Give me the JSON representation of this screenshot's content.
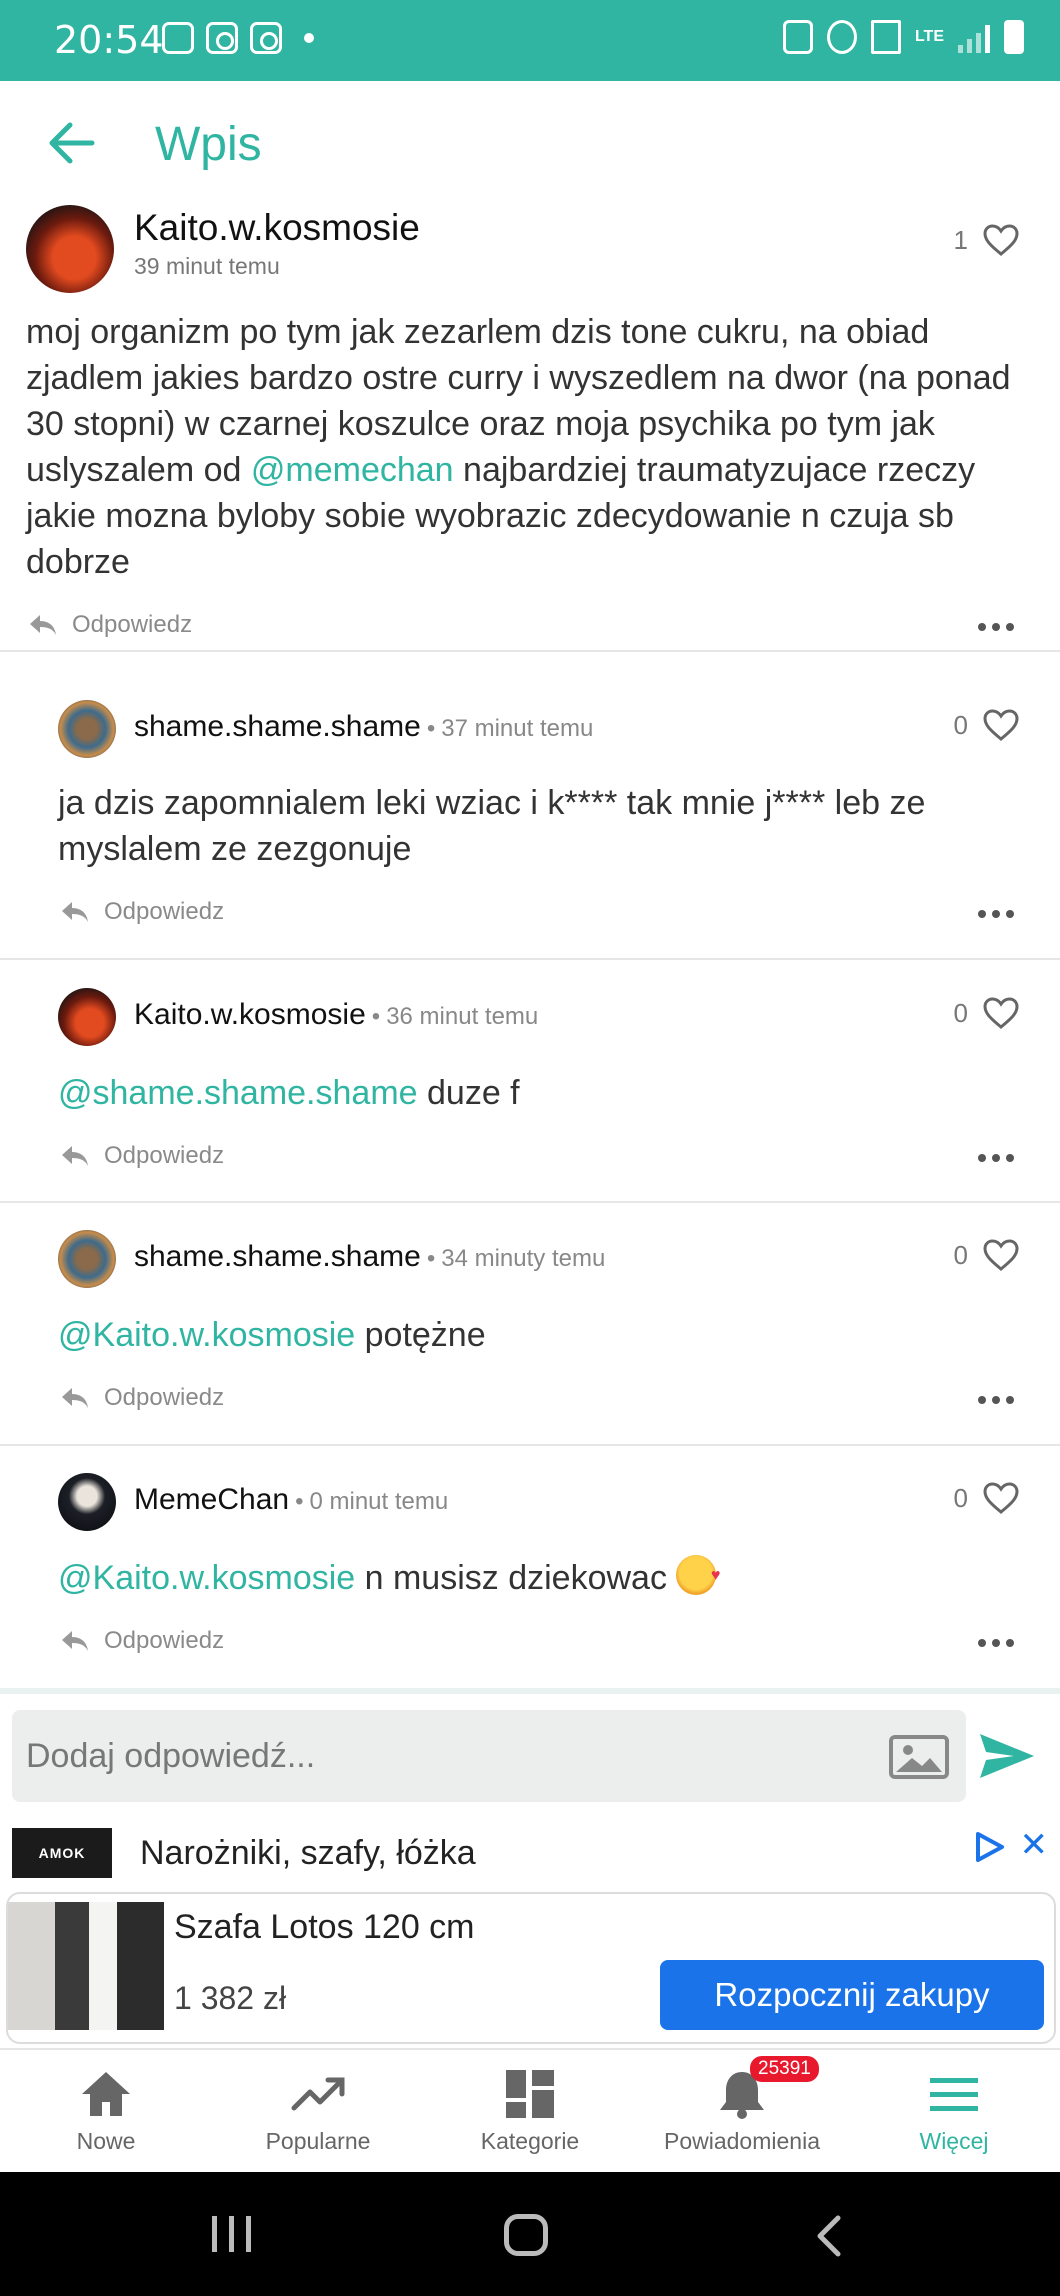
{
  "status_bar": {
    "time": "20:54",
    "network": "LTE"
  },
  "header": {
    "title": "Wpis",
    "back_icon": "back-arrow-icon"
  },
  "post": {
    "author": "Kaito.w.kosmosie",
    "time": "39 minut temu",
    "likes": "1",
    "body_part1": "moj organizm po tym jak zezarlem dzis tone cukru, na obiad zjadlem jakies bardzo ostre curry i wyszedlem na dwor (na ponad 30 stopni) w czarnej koszulce oraz moja psychika po tym jak uslyszalem od ",
    "body_mention": "@memechan",
    "body_part2": " najbardziej traumatyzujace rzeczy jakie mozna byloby sobie wyobrazic zdecydowanie n czuja sb dobrze",
    "reply_label": "Odpowiedz"
  },
  "comments": [
    {
      "author": "shame.shame.shame",
      "separator": "•",
      "time": "37 minut temu",
      "likes": "0",
      "mention": "",
      "text": "ja dzis zapomnialem leki wziac i k**** tak mnie j**** leb ze myslalem ze zezgonuje",
      "reply_label": "Odpowiedz"
    },
    {
      "author": "Kaito.w.kosmosie",
      "separator": "•",
      "time": "36 minut temu",
      "likes": "0",
      "mention": "@shame.shame.shame",
      "text": " duze f",
      "reply_label": "Odpowiedz"
    },
    {
      "author": "shame.shame.shame",
      "separator": "•",
      "time": "34 minuty temu",
      "likes": "0",
      "mention": "@Kaito.w.kosmosie",
      "text": " potężne",
      "reply_label": "Odpowiedz"
    },
    {
      "author": "MemeChan",
      "separator": "•",
      "time": "0 minut temu",
      "likes": "0",
      "mention": "@Kaito.w.kosmosie",
      "text": " n musisz dziekowac ",
      "reply_label": "Odpowiedz"
    }
  ],
  "compose": {
    "placeholder": "Dodaj odpowiedź..."
  },
  "ad": {
    "logo": "AMOK",
    "headline": "Narożniki, szafy, łóżka",
    "product": "Szafa Lotos 120 cm",
    "price": "1 382 zł",
    "cta": "Rozpocznij zakupy"
  },
  "bottom_nav": {
    "items": [
      {
        "label": "Nowe",
        "icon": "home-icon"
      },
      {
        "label": "Popularne",
        "icon": "trending-icon"
      },
      {
        "label": "Kategorie",
        "icon": "dashboard-icon"
      },
      {
        "label": "Powiadomienia",
        "icon": "bell-icon",
        "badge": "25391"
      },
      {
        "label": "Więcej",
        "icon": "menu-icon",
        "active": true
      }
    ]
  },
  "colors": {
    "accent": "#2fb5a1",
    "ad_blue": "#1a73e8",
    "badge_red": "#e8192c"
  }
}
